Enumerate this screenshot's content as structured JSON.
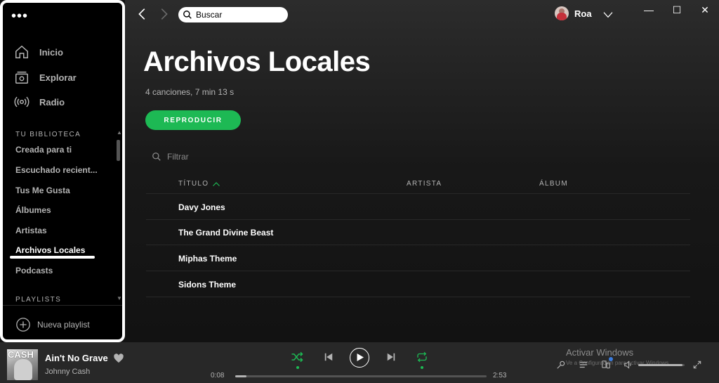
{
  "sidebar": {
    "menu_dots": "•••",
    "nav": [
      {
        "label": "Inicio",
        "icon": "home-icon"
      },
      {
        "label": "Explorar",
        "icon": "browse-icon"
      },
      {
        "label": "Radio",
        "icon": "radio-icon"
      }
    ],
    "library_title": "TU BIBLIOTECA",
    "library": [
      {
        "label": "Creada para ti"
      },
      {
        "label": "Escuchado recient..."
      },
      {
        "label": "Tus Me Gusta"
      },
      {
        "label": "Álbumes"
      },
      {
        "label": "Artistas"
      },
      {
        "label": "Archivos Locales",
        "active": true
      },
      {
        "label": "Podcasts"
      }
    ],
    "playlists_title": "PLAYLISTS",
    "new_playlist_label": "Nueva playlist"
  },
  "header": {
    "search_value": "Buscar",
    "user_name": "Roa"
  },
  "window_controls": {
    "minimize": "—",
    "maximize": "☐",
    "close": "✕"
  },
  "main": {
    "title": "Archivos Locales",
    "meta": "4 canciones, 7 min 13 s",
    "play_label": "REPRODUCIR",
    "filter_placeholder": "Filtrar",
    "columns": {
      "title": "TÍTULO",
      "artist": "ARTISTA",
      "album": "ÁLBUM"
    },
    "tracks": [
      {
        "title": "Davy Jones",
        "artist": "",
        "album": ""
      },
      {
        "title": "The Grand Divine Beast",
        "artist": "",
        "album": ""
      },
      {
        "title": "Miphas Theme",
        "artist": "",
        "album": ""
      },
      {
        "title": "Sidons Theme",
        "artist": "",
        "album": ""
      }
    ]
  },
  "player": {
    "cover_text": "CASH",
    "song_title": "Ain't No Grave",
    "song_artist": "Johnny Cash",
    "elapsed": "0:08",
    "duration": "2:53",
    "progress_fraction": 0.046,
    "volume_fraction": 0.95,
    "shuffle_on": true,
    "repeat_on": true
  },
  "overlay": {
    "watermark_title": "Activar Windows",
    "watermark_sub": "Ve a Configuración para activar Windows."
  },
  "colors": {
    "accent": "#1db954",
    "sidebar_bg": "#000000",
    "player_bg": "#282828"
  }
}
